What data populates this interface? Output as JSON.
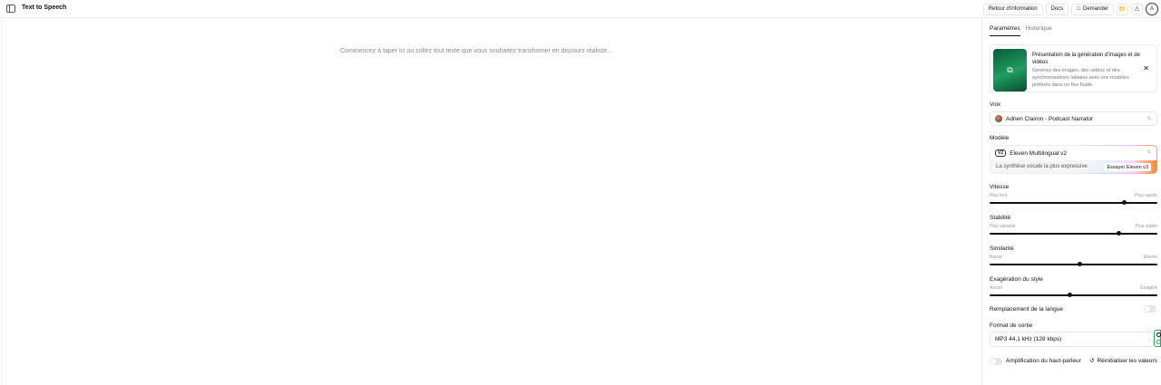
{
  "header": {
    "title": "Text to Speech",
    "feedback_label": "Retour d'information",
    "docs_label": "Docs",
    "ask_label": "Demander",
    "avatar_initial": "A"
  },
  "editor": {
    "placeholder": "Commencez à taper ici ou collez tout texte que vous souhaitez transformer en discours réaliste..."
  },
  "panel": {
    "tabs": [
      {
        "label": "Paramètres",
        "active": true
      },
      {
        "label": "Historique",
        "active": false
      }
    ],
    "promo": {
      "title": "Présentation de la génération d'images et de vidéos",
      "description": "Générez des images, des vidéos et des synchronisations labiales avec vos modèles préférés dans un flux fluide."
    },
    "voice": {
      "label": "Voix",
      "value": "Adrien Clairon - Podcast Narrator"
    },
    "model": {
      "label": "Modèle",
      "badge": "V2",
      "value": "Eleven Multilingual v2",
      "subtitle": "La synthèse vocale la plus expressive",
      "try_label": "Essayer Eleven v3"
    },
    "sliders": [
      {
        "title": "Vitesse",
        "min_label": "Plus lent",
        "max_label": "Plus rapide",
        "value": 0.8
      },
      {
        "title": "Stabilité",
        "min_label": "Plus variable",
        "max_label": "Plus stable",
        "value": 0.77
      },
      {
        "title": "Similarité",
        "min_label": "Basse",
        "max_label": "Élevée",
        "value": 0.54
      },
      {
        "title": "Exagération du style",
        "min_label": "Aucun",
        "max_label": "Exagéré",
        "value": 0.48
      }
    ],
    "language_override": {
      "label": "Remplacement de la langue",
      "on": false
    },
    "output_format": {
      "label": "Format de sortie",
      "value": "MP3 44,1 kHz (128 kbps)"
    },
    "speaker_boost": {
      "label": "Amplification du haut-parleur",
      "on": false
    },
    "reset_label": "Réinitialiser les valeurs"
  }
}
